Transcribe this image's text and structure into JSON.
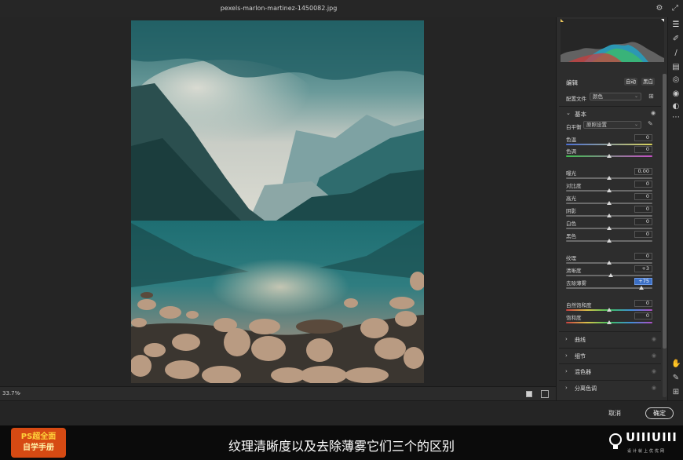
{
  "window": {
    "title": "pexels-marlon-martinez-1450082.jpg"
  },
  "canvas": {
    "zoom": "33.7%"
  },
  "panel": {
    "edit_label": "编辑",
    "auto_label": "自动",
    "bw_label": "黑白",
    "profile_label": "配置文件",
    "profile_value": "颜色",
    "basic_label": "基本",
    "wb_label": "白平衡",
    "wb_value": "原照设置",
    "sliders": [
      {
        "label": "色温",
        "value": "0",
        "gradient": "temp"
      },
      {
        "label": "色调",
        "value": "0",
        "gradient": "tint"
      },
      {
        "label": "曝光",
        "value": "0.00",
        "gradient": "gray"
      },
      {
        "label": "对比度",
        "value": "0",
        "gradient": "gray"
      },
      {
        "label": "高光",
        "value": "0",
        "gradient": "gray"
      },
      {
        "label": "阴影",
        "value": "0",
        "gradient": "gray"
      },
      {
        "label": "白色",
        "value": "0",
        "gradient": "gray"
      },
      {
        "label": "黑色",
        "value": "0",
        "gradient": "gray"
      },
      {
        "label": "纹理",
        "value": "0",
        "gradient": "gray"
      },
      {
        "label": "清晰度",
        "value": "+3",
        "gradient": "gray"
      },
      {
        "label": "去除薄雾",
        "value": "+75",
        "gradient": "gray",
        "active": true
      },
      {
        "label": "自然饱和度",
        "value": "0",
        "gradient": "sat"
      },
      {
        "label": "饱和度",
        "value": "0",
        "gradient": "sat"
      }
    ],
    "slider_levels": [
      0.5,
      0.5,
      0.5,
      0.5,
      0.5,
      0.5,
      0.5,
      0.5,
      0.5,
      0.515,
      0.875,
      0.5,
      0.5
    ],
    "sections": [
      {
        "label": "曲线"
      },
      {
        "label": "细节"
      },
      {
        "label": "混色器"
      },
      {
        "label": "分离色调"
      }
    ]
  },
  "footer": {
    "cancel": "取消",
    "ok": "确定"
  },
  "subtitle": {
    "caption": "纹理清晰度以及去除薄雾它们三个的区别",
    "badge_line1": "PS超全面",
    "badge_line2": "自学手册",
    "logo_text": "UIIIUIII",
    "logo_sub": "设计就上优优网"
  },
  "colors": {
    "accent": "#3b6fc4",
    "panel": "#2d2d2d",
    "badge": "#d64a13"
  },
  "icons": [
    "settings-icon",
    "fullscreen-icon",
    "sliders-icon",
    "brush-icon",
    "gradient-icon",
    "radial-icon",
    "redeye-icon",
    "presets-icon",
    "more-icon",
    "hand-icon",
    "eyedropper-icon",
    "grid-icon",
    "eye-icon"
  ]
}
